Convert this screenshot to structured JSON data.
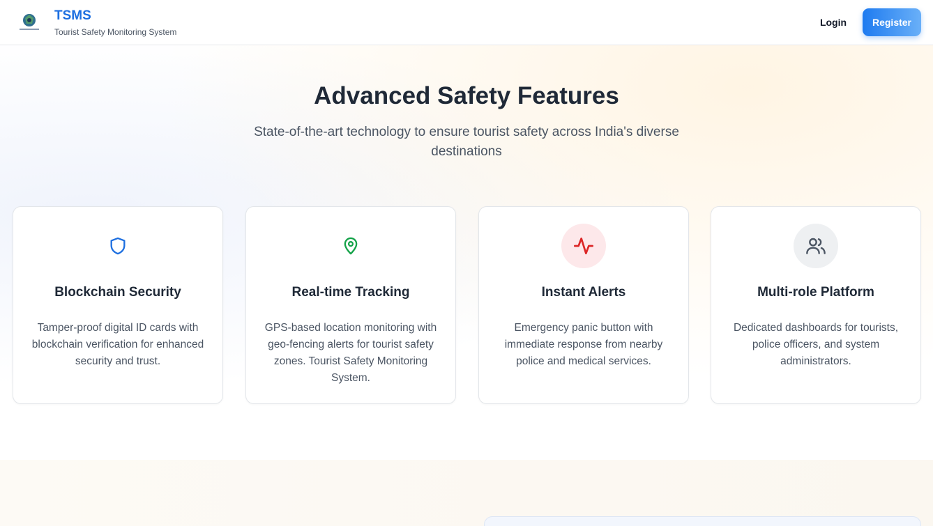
{
  "header": {
    "title": "TSMS",
    "subtitle": "Tourist Safety Monitoring System",
    "login_label": "Login",
    "register_label": "Register"
  },
  "features": {
    "title": "Advanced Safety Features",
    "subtitle": "State-of-the-art technology to ensure tourist safety across India's diverse destinations",
    "cards": [
      {
        "icon": "shield-icon",
        "title": "Blockchain Security",
        "description": "Tamper-proof digital ID cards with blockchain verification for enhanced security and trust.",
        "color": "#1d6fe0"
      },
      {
        "icon": "map-pin-icon",
        "title": "Real-time Tracking",
        "description": "GPS-based location monitoring with geo-fencing alerts for tourist safety zones. Tourist Safety Monitoring System.",
        "color": "#16a34a"
      },
      {
        "icon": "activity-icon",
        "title": "Instant Alerts",
        "description": "Emergency panic button with immediate response from nearby police and medical services.",
        "color": "#dc2626"
      },
      {
        "icon": "users-icon",
        "title": "Multi-role Platform",
        "description": "Dedicated dashboards for tourists, police officers, and system administrators.",
        "color": "#4b5563"
      }
    ]
  },
  "colors": {
    "brand": "#1d6fe0",
    "register_gradient_start": "#1e7bf0",
    "register_gradient_end": "#6ab0f8"
  }
}
